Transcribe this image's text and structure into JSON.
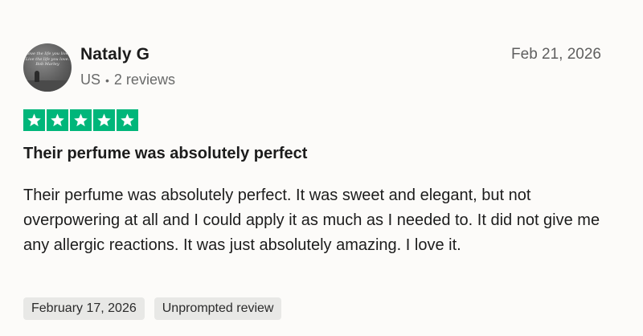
{
  "review": {
    "reviewer": {
      "name": "Nataly G",
      "country": "US",
      "separator": "•",
      "review_count": "2 reviews",
      "avatar_text": "Love the life you live. Live the life you love. Bob Marley"
    },
    "date": "Feb 21, 2026",
    "rating": {
      "stars": 5,
      "max": 5,
      "color": "#00b67a",
      "icon": "star-icon"
    },
    "title": "Their perfume was absolutely perfect",
    "body": "Their perfume was absolutely perfect. It was sweet and elegant, but not overpowering at all and I could apply it as much as I needed to. It did not give me any allergic reactions. It was just absolutely amazing. I love it.",
    "tags": {
      "experience_date": "February 17, 2026",
      "review_type": "Unprompted review"
    }
  }
}
